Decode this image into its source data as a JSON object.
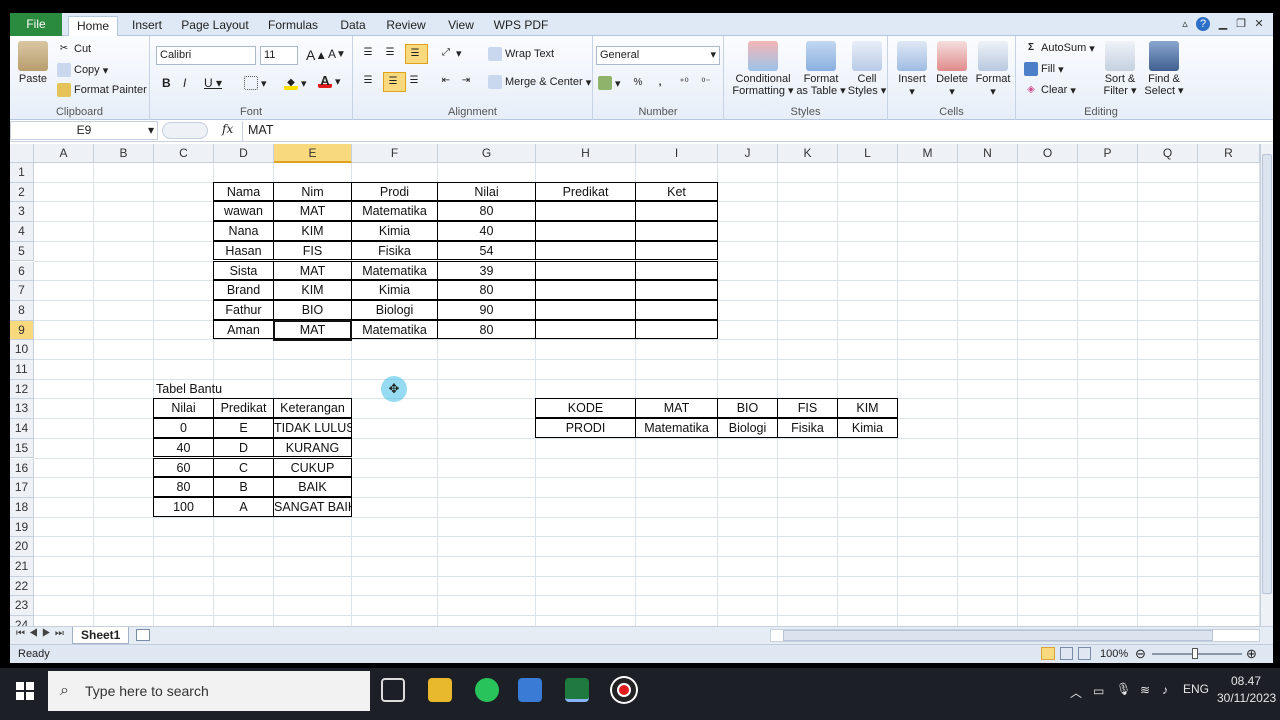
{
  "ribbon": {
    "tabs": [
      "File",
      "Home",
      "Insert",
      "Page Layout",
      "Formulas",
      "Data",
      "Review",
      "View",
      "WPS PDF"
    ],
    "clipboard": {
      "paste": "Paste",
      "cut": "Cut",
      "copy": "Copy",
      "format_painter": "Format Painter",
      "label": "Clipboard"
    },
    "font": {
      "name": "Calibri",
      "size": "11",
      "label": "Font"
    },
    "alignment": {
      "wrap": "Wrap Text",
      "merge": "Merge & Center",
      "label": "Alignment"
    },
    "number": {
      "format": "General",
      "label": "Number"
    },
    "styles": {
      "cond1": "Conditional",
      "cond2": "Formatting",
      "fmt1": "Format",
      "fmt2": "as Table",
      "cell1": "Cell",
      "cell2": "Styles",
      "label": "Styles"
    },
    "cells": {
      "insert": "Insert",
      "delete": "Delete",
      "format": "Format",
      "label": "Cells"
    },
    "editing": {
      "autosum": "AutoSum",
      "fill": "Fill",
      "clear": "Clear",
      "sort1": "Sort &",
      "sort2": "Filter",
      "find1": "Find &",
      "find2": "Select",
      "label": "Editing"
    }
  },
  "formula_bar": {
    "name_box": "E9",
    "fx": "fx",
    "content": "MAT"
  },
  "columns": [
    "A",
    "B",
    "C",
    "D",
    "E",
    "F",
    "G",
    "H",
    "I",
    "J",
    "K",
    "L",
    "M",
    "N",
    "O",
    "P",
    "Q",
    "R"
  ],
  "rows": [
    "1",
    "2",
    "3",
    "4",
    "5",
    "6",
    "7",
    "8",
    "9",
    "10",
    "11",
    "12",
    "13",
    "14",
    "15",
    "16",
    "17",
    "18",
    "19",
    "20",
    "21",
    "22",
    "23",
    "24"
  ],
  "main_table": {
    "headers": [
      "Nama",
      "Nim",
      "Prodi",
      "Nilai",
      "Predikat",
      "Ket"
    ],
    "rows": [
      [
        "wawan",
        "MAT",
        "Matematika",
        "80",
        "",
        ""
      ],
      [
        "Nana",
        "KIM",
        "Kimia",
        "40",
        "",
        ""
      ],
      [
        "Hasan",
        "FIS",
        "Fisika",
        "54",
        "",
        ""
      ],
      [
        "Sista",
        "MAT",
        "Matematika",
        "39",
        "",
        ""
      ],
      [
        "Brand",
        "KIM",
        "Kimia",
        "80",
        "",
        ""
      ],
      [
        "Fathur",
        "BIO",
        "Biologi",
        "90",
        "",
        ""
      ],
      [
        "Aman",
        "MAT",
        "Matematika",
        "80",
        "",
        ""
      ]
    ]
  },
  "helper_title": "Tabel Bantu",
  "helper_table": {
    "headers": [
      "Nilai",
      "Predikat",
      "Keterangan"
    ],
    "rows": [
      [
        "0",
        "E",
        "TIDAK LULUS"
      ],
      [
        "40",
        "D",
        "KURANG"
      ],
      [
        "60",
        "C",
        "CUKUP"
      ],
      [
        "80",
        "B",
        "BAIK"
      ],
      [
        "100",
        "A",
        "SANGAT BAIK"
      ]
    ]
  },
  "code_table": {
    "rows": [
      [
        "KODE",
        "MAT",
        "BIO",
        "FIS",
        "KIM"
      ],
      [
        "PRODI",
        "Matematika",
        "Biologi",
        "Fisika",
        "Kimia"
      ]
    ]
  },
  "sheet_tab": "Sheet1",
  "status": {
    "ready": "Ready",
    "zoom": "100%"
  },
  "taskbar": {
    "search": "Type here to search",
    "lang": "ENG",
    "time": "08.47",
    "date": "30/11/2023"
  }
}
